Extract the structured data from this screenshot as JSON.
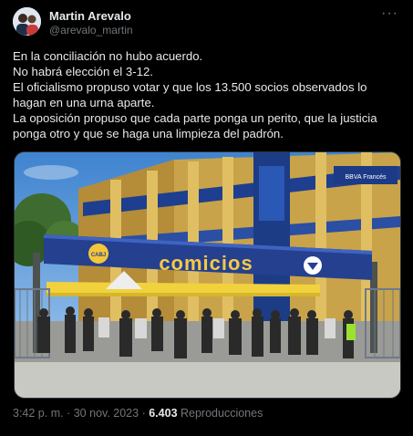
{
  "author": {
    "name": "Martin Arevalo",
    "handle": "@arevalo_martin"
  },
  "menu_icon": "more-icon",
  "tweet_lines": [
    "En la conciliación no hubo acuerdo.",
    "No habrá elección el 3-12.",
    "El oficialismo propuso votar y que los 13.500 socios observados lo hagan en una urna aparte.",
    "La oposición propuso que cada parte ponga un perito, que la justicia ponga otro y que se haga una limpieza del padrón."
  ],
  "photo": {
    "banner_text": "comicios",
    "sign_text": "BBVA Francés",
    "logo_text": "CABJ"
  },
  "footer": {
    "time": "3:42 p. m.",
    "separator": "·",
    "date": "30 nov. 2023",
    "views_count": "6.403",
    "views_label": "Reproducciones"
  }
}
